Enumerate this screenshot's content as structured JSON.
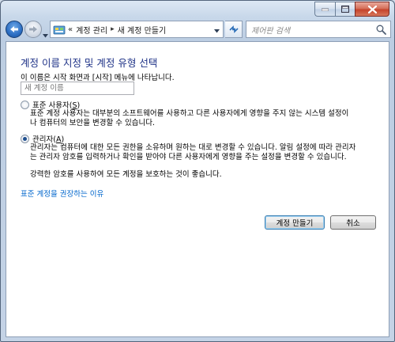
{
  "window": {
    "controls": {
      "minimize": "minimize",
      "maximize": "maximize",
      "close": "close"
    }
  },
  "nav": {
    "breadcrumb": {
      "prefix": "«",
      "part1": "계정 관리",
      "separator": "▸",
      "part2": "새 계정 만들기"
    },
    "search": {
      "placeholder": "제어판 검색"
    }
  },
  "main": {
    "title": "계정 이름 지정 및 계정 유형 선택",
    "name_hint": "이 이름은 시작 화면과 [시작] 메뉴에 나타납니다.",
    "name_input": {
      "value": "",
      "placeholder": "새 계정 이름"
    },
    "standard": {
      "label_text": "표준 사용자(",
      "label_key": "S",
      "label_end": ")",
      "checked": false,
      "desc_line1": "표준 계정 사용자는 대부분의 소프트웨어를 사용하고 다른 사용자에게 영향을 주지 않는 시스템 설정이",
      "desc_line2": "나 컴퓨터의 보안을 변경할 수 있습니다."
    },
    "admin": {
      "label_text": "관리자(",
      "label_key": "A",
      "label_end": ")",
      "checked": true,
      "desc_line1": "관리자는 컴퓨터에 대한 모든 권한을 소유하며 원하는 대로 변경할 수 있습니다. 알림 설정에 따라 관리자",
      "desc_line2": "는 관리자 암호를 입력하거나 확인을 받아야 다른 사용자에게 영향을 주는 설정을 변경할 수 있습니다.",
      "desc_line3": "강력한 암호를 사용하여 모든 계정을 보호하는 것이 좋습니다."
    },
    "link": "표준 계정을 권장하는 이유",
    "buttons": {
      "create": "계정 만들기",
      "cancel": "취소"
    }
  },
  "colors": {
    "title": "#1e3287",
    "link": "#0066cc",
    "close_button": "#c5432b"
  }
}
